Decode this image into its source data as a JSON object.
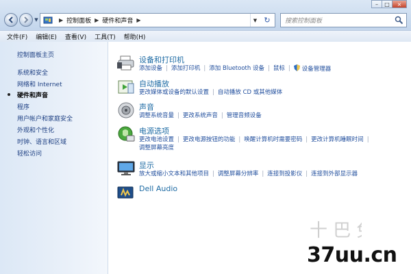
{
  "address": {
    "crumbs": [
      "控制面板",
      "硬件和声音"
    ]
  },
  "search": {
    "placeholder": "搜索控制面板"
  },
  "menu": {
    "items": [
      "文件(F)",
      "编辑(E)",
      "查看(V)",
      "工具(T)",
      "帮助(H)"
    ]
  },
  "sidebar": {
    "home": "控制面板主页",
    "items": [
      {
        "label": "系统和安全"
      },
      {
        "label": "网络和 Internet"
      },
      {
        "label": "硬件和声音",
        "current": true
      },
      {
        "label": "程序"
      },
      {
        "label": "用户帐户和家庭安全"
      },
      {
        "label": "外观和个性化"
      },
      {
        "label": "时钟、语言和区域"
      },
      {
        "label": "轻松访问"
      }
    ]
  },
  "categories": [
    {
      "title": "设备和打印机",
      "icon": "printer-icon",
      "links": [
        "添加设备",
        "添加打印机",
        "添加 Bluetooth 设备",
        "鼠标",
        "设备管理器"
      ]
    },
    {
      "title": "自动播放",
      "icon": "autoplay-icon",
      "links": [
        "更改媒体或设备的默认设置",
        "自动播放 CD 或其他媒体"
      ]
    },
    {
      "title": "声音",
      "icon": "speaker-icon",
      "links": [
        "调整系统音量",
        "更改系统声音",
        "管理音频设备"
      ]
    },
    {
      "title": "电源选项",
      "icon": "power-icon",
      "links": [
        "更改电池设置",
        "更改电源按钮的功能",
        "唤醒计算机时需要密码",
        "更改计算机睡眠时间",
        "调整屏幕亮度"
      ]
    },
    {
      "title": "显示",
      "icon": "display-icon",
      "links": [
        "放大或缩小文本和其他项目",
        "调整屏幕分辨率",
        "连接到投影仪",
        "连接到外部显示器"
      ]
    },
    {
      "title": "Dell Audio",
      "icon": "audio-icon",
      "links": []
    }
  ],
  "watermark": {
    "text": "37uu.cn"
  }
}
